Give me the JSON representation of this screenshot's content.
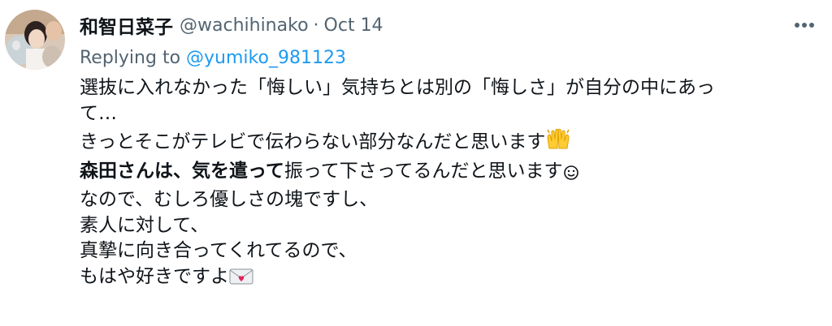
{
  "author": {
    "display_name": "和智日菜子",
    "handle": "@wachihinako",
    "separator": "·",
    "date": "Oct 14"
  },
  "reply": {
    "prefix": "Replying to ",
    "mention": "@yumiko_981123"
  },
  "body": {
    "line1": "選抜に入れなかった「悔しい」気持ちとは別の「悔しさ」が自分の中にあっ",
    "line2": "て…",
    "line3": "きっとそこがテレビで伝わらない部分なんだと思います",
    "line4_bold": "森田さんは、気を遣って",
    "line4_rest": "振って下さってるんだと思います",
    "line5": "なので、むしろ優しさの塊ですし、",
    "line6": "素人に対して、",
    "line7": "真摯に向き合ってくれてるので、",
    "line8": "もはや好きですよ"
  },
  "icons": {
    "more": "more-horizontal-icon",
    "raised_hands": "raising-hands-emoji",
    "smile": "smiling-face-emoji",
    "love_letter": "love-letter-emoji"
  },
  "colors": {
    "text": "#0f1419",
    "muted": "#536471",
    "link": "#1d9bf0"
  }
}
